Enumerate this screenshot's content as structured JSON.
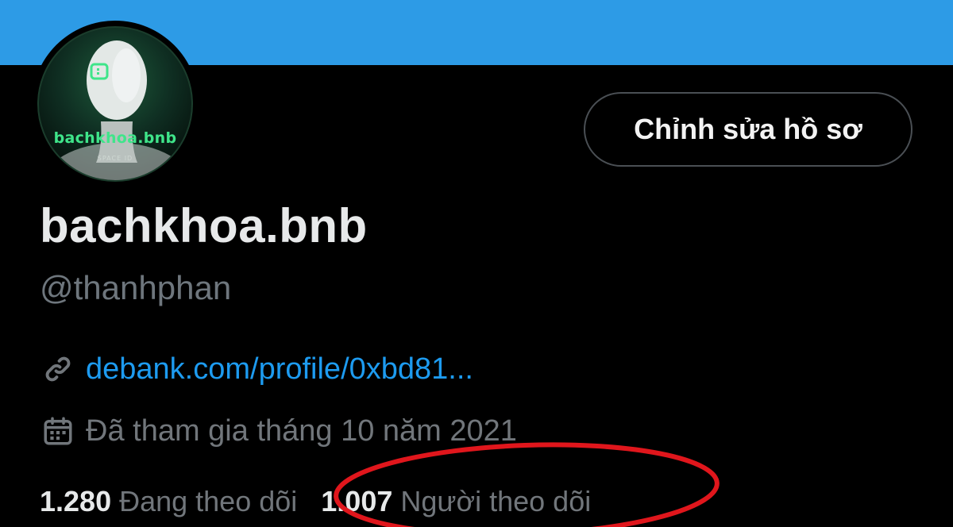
{
  "colors": {
    "banner": "#2d9be6",
    "background": "#000000",
    "link": "#1d9bf0",
    "muted": "#71767b",
    "text": "#e7e9ea",
    "avatar_accent": "#3fe58a",
    "annotation": "#e0161c"
  },
  "avatar": {
    "name": "bachkhoa.bnb",
    "badge": "SPACE ID"
  },
  "edit_profile_button": "Chỉnh sửa hồ sơ",
  "profile": {
    "display_name": "bachkhoa.bnb",
    "handle": "@thanhphan"
  },
  "link": {
    "icon": "link-icon",
    "text": "debank.com/profile/0xbd81..."
  },
  "joined": {
    "icon": "calendar-icon",
    "text": "Đã tham gia tháng 10 năm 2021"
  },
  "stats": {
    "following_count": "1.280",
    "following_label": "Đang theo dõi",
    "followers_count": "1.007",
    "followers_label": "Người theo dõi"
  }
}
